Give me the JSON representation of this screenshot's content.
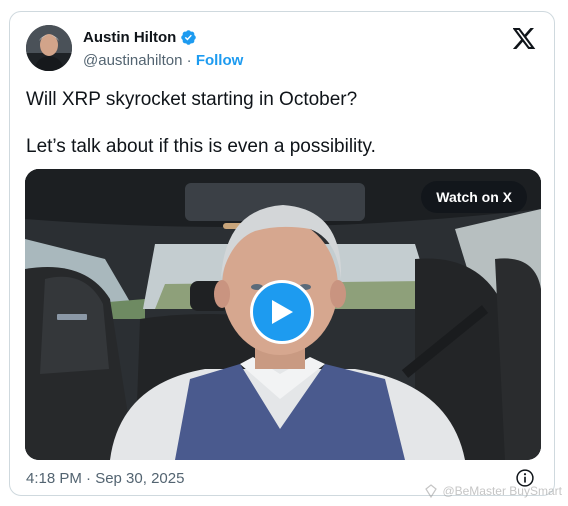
{
  "post": {
    "author": {
      "display_name": "Austin Hilton",
      "handle": "@austinahilton",
      "separator": "·",
      "follow_label": "Follow",
      "verified": true
    },
    "brand_icon": "x-logo-icon",
    "text_lines": [
      "Will XRP skyrocket starting in October?",
      "Let’s talk about if this is even a possibility."
    ],
    "media": {
      "type": "video",
      "watch_label": "Watch on X",
      "play_icon": "play-icon"
    },
    "timestamp": "4:18 PM · Sep 30, 2025",
    "info_icon": "info-icon"
  },
  "watermark": "@BeMaster BuySmart",
  "colors": {
    "accent": "#1d9bf0",
    "text_primary": "#0f1419",
    "text_secondary": "#536471",
    "border": "#cfd9de"
  }
}
